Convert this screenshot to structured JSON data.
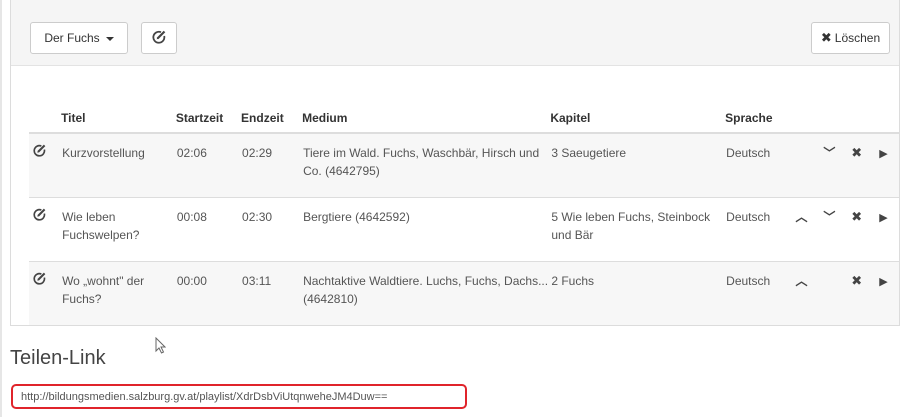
{
  "toolbar": {
    "playlist_dropdown_label": "Der Fuchs",
    "delete_label": "Löschen",
    "edit_icon": "edit-icon",
    "delete_icon": "close-icon"
  },
  "table": {
    "headers": {
      "title": "Titel",
      "start": "Startzeit",
      "end": "Endzeit",
      "medium": "Medium",
      "chapter": "Kapitel",
      "language": "Sprache"
    },
    "rows": [
      {
        "title": "Kurzvorstellung",
        "start": "02:06",
        "end": "02:29",
        "medium": "Tiere im Wald. Fuchs, Waschbär, Hirsch und Co. (4642795)",
        "chapter": "3 Saeugetiere",
        "language": "Deutsch",
        "can_move_up": false,
        "can_move_down": true
      },
      {
        "title": "Wie leben Fuchswelpen?",
        "start": "00:08",
        "end": "02:30",
        "medium": "Bergtiere (4642592)",
        "chapter": "5 Wie leben Fuchs, Steinbock und Bär",
        "language": "Deutsch",
        "can_move_up": true,
        "can_move_down": true
      },
      {
        "title": "Wo „wohnt\" der Fuchs?",
        "start": "00:00",
        "end": "03:11",
        "medium": "Nachtaktive Waldtiere. Luchs, Fuchs, Dachs... (4642810)",
        "chapter": "2 Fuchs",
        "language": "Deutsch",
        "can_move_up": true,
        "can_move_down": false
      }
    ]
  },
  "share": {
    "title": "Teilen-Link",
    "url": "http://bildungsmedien.salzburg.gv.at/playlist/XdrDsbViUtqnweheJM4Duw=="
  },
  "colors": {
    "highlight_border": "#e0242b",
    "header_bg": "#f5f5f5",
    "stripe_bg": "#f7f7f7"
  }
}
